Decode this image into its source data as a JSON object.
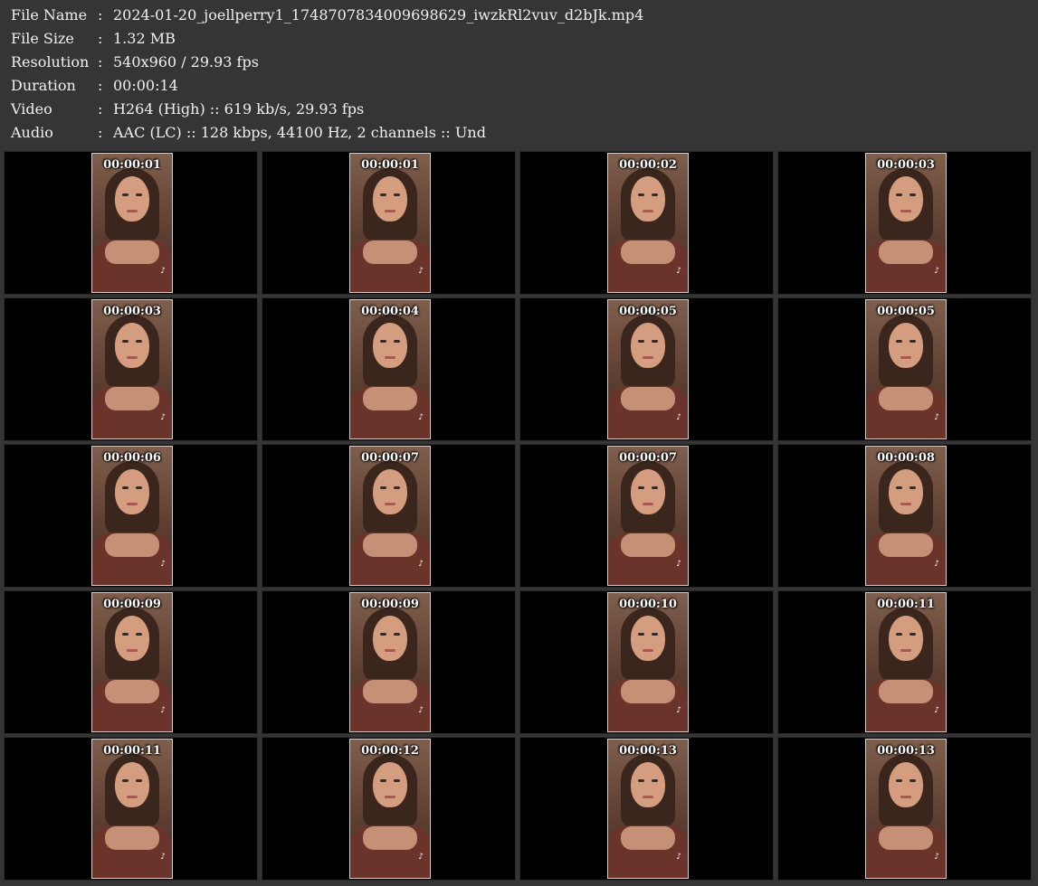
{
  "info": [
    {
      "label": "File Name",
      "sep": ":",
      "value": "2024-01-20_joellperry1_1748707834009698629_iwzkRl2vuv_d2bJk.mp4"
    },
    {
      "label": "File Size",
      "sep": ":",
      "value": "1.32 MB"
    },
    {
      "label": "Resolution",
      "sep": ":",
      "value": "540x960 / 29.93 fps"
    },
    {
      "label": "Duration",
      "sep": ":",
      "value": "00:00:14"
    },
    {
      "label": "Video",
      "sep": ":",
      "value": "H264 (High) :: 619 kb/s, 29.93 fps"
    },
    {
      "label": "Audio",
      "sep": ":",
      "value": "AAC (LC) :: 128 kbps, 44100 Hz, 2 channels :: Und"
    }
  ],
  "thumbnails": [
    {
      "time": "00:00:01",
      "icon": "tiktok-logo-icon"
    },
    {
      "time": "00:00:01",
      "icon": "tiktok-logo-icon"
    },
    {
      "time": "00:00:02",
      "icon": "tiktok-logo-icon"
    },
    {
      "time": "00:00:03",
      "icon": "tiktok-logo-icon"
    },
    {
      "time": "00:00:03",
      "icon": "tiktok-logo-icon"
    },
    {
      "time": "00:00:04",
      "icon": "tiktok-logo-icon"
    },
    {
      "time": "00:00:05",
      "icon": "tiktok-logo-icon"
    },
    {
      "time": "00:00:05",
      "icon": "tiktok-logo-icon"
    },
    {
      "time": "00:00:06",
      "icon": "tiktok-logo-icon"
    },
    {
      "time": "00:00:07",
      "icon": "tiktok-logo-icon"
    },
    {
      "time": "00:00:07",
      "icon": "tiktok-logo-icon"
    },
    {
      "time": "00:00:08",
      "icon": "tiktok-logo-icon"
    },
    {
      "time": "00:00:09",
      "icon": "tiktok-logo-icon"
    },
    {
      "time": "00:00:09",
      "icon": "tiktok-logo-icon"
    },
    {
      "time": "00:00:10",
      "icon": "tiktok-logo-icon"
    },
    {
      "time": "00:00:11",
      "icon": "tiktok-logo-icon"
    },
    {
      "time": "00:00:11",
      "icon": "tiktok-logo-icon"
    },
    {
      "time": "00:00:12",
      "icon": "tiktok-logo-icon"
    },
    {
      "time": "00:00:13",
      "icon": "tiktok-logo-icon"
    },
    {
      "time": "00:00:13",
      "icon": "tiktok-logo-icon"
    }
  ],
  "colors": {
    "background": "#353535",
    "cell_background": "#000000",
    "text": "#f0f0f0"
  }
}
